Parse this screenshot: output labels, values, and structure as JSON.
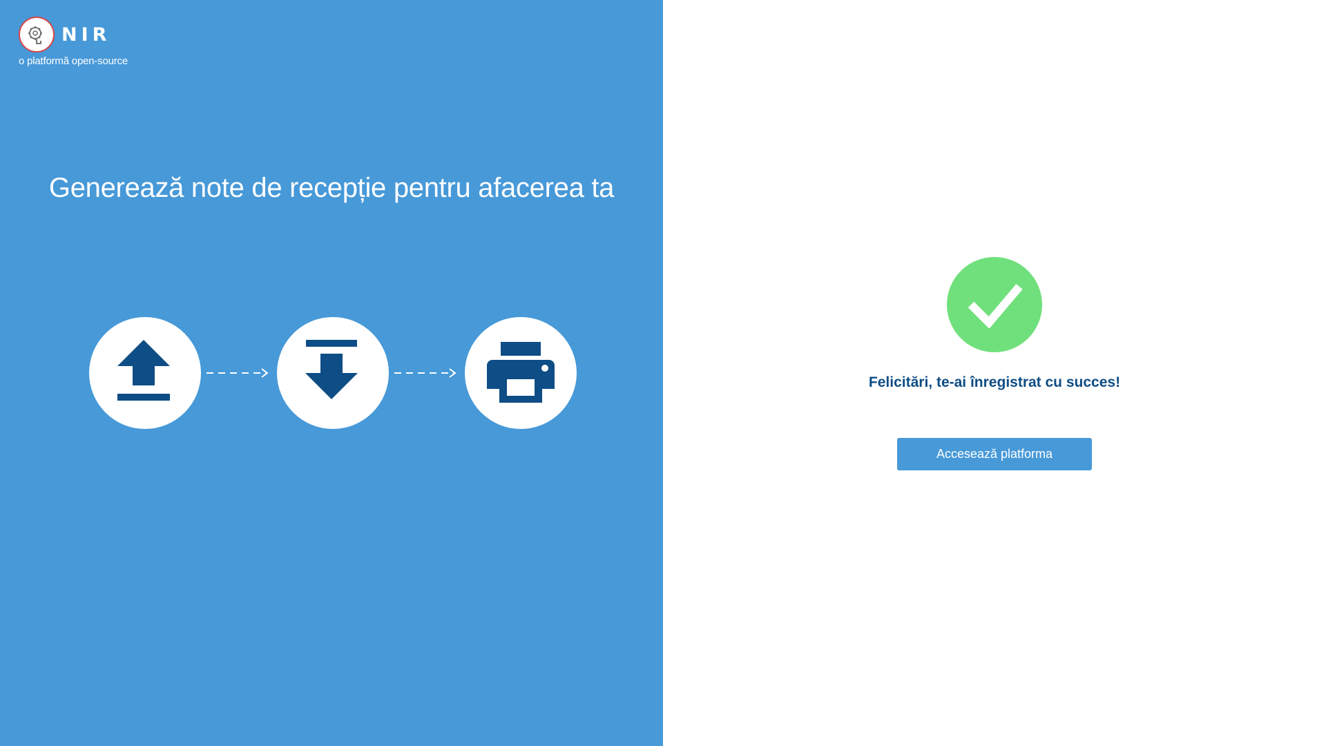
{
  "logo": {
    "name": "NIR",
    "tagline": "o platformă open-source",
    "icon": "brain-gears-icon",
    "border_color": "#d64545"
  },
  "headline": "Generează note de recepție pentru afacerea ta",
  "steps": [
    {
      "icon": "upload-icon"
    },
    {
      "icon": "download-icon"
    },
    {
      "icon": "printer-icon"
    }
  ],
  "success": {
    "icon": "checkmark-icon",
    "message": "Felicitări, te-ai înregistrat cu succes!",
    "button_label": "Accesează platforma"
  },
  "colors": {
    "brand_blue": "#4799d8",
    "icon_dark_blue": "#0e4d85",
    "success_green": "#70e07c",
    "background": "#ffffff"
  }
}
